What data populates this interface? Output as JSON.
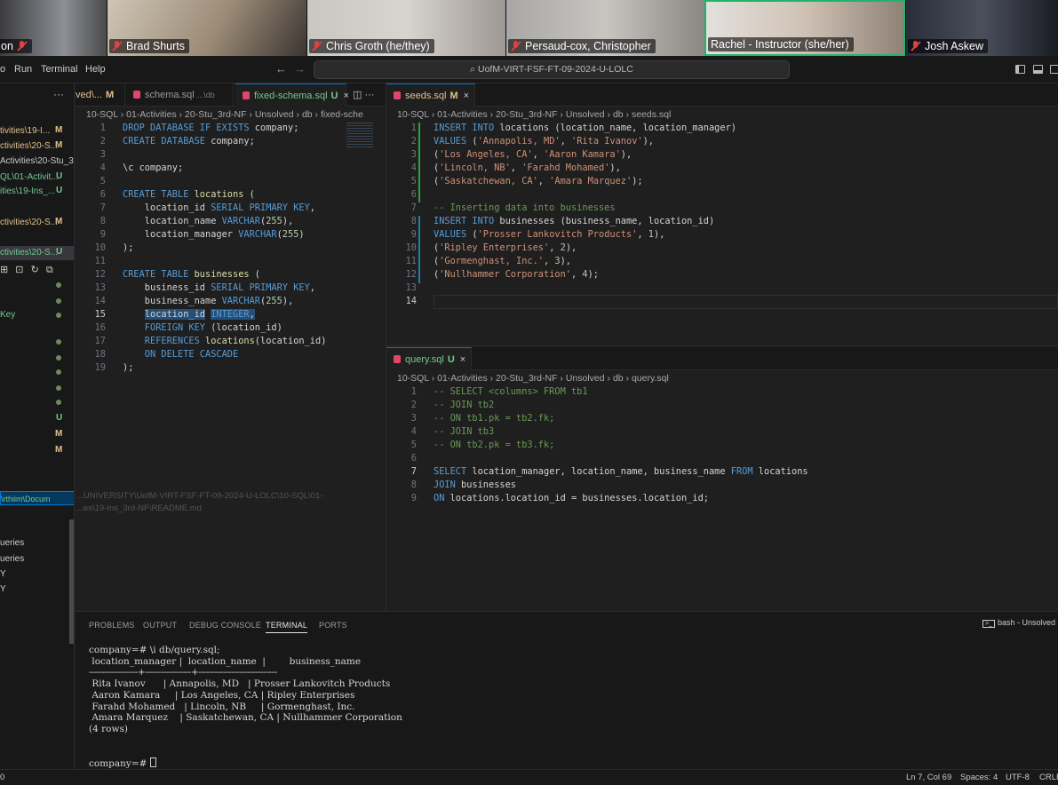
{
  "video_strip": {
    "participants": [
      {
        "name": "on",
        "muted": true
      },
      {
        "name": "Brad Shurts",
        "muted": true
      },
      {
        "name": "Chris Groth (he/they)",
        "muted": true
      },
      {
        "name": "Persaud-cox, Christopher",
        "muted": true
      },
      {
        "name": "Rachel - Instructor (she/her)",
        "muted": false
      },
      {
        "name": "Josh Askew",
        "muted": true
      }
    ]
  },
  "menubar": {
    "items": [
      "o",
      "Run",
      "Terminal",
      "Help"
    ],
    "command_center": "UofM-VIRT-FSF-FT-09-2024-U-LOLC"
  },
  "sidebar": {
    "rows": [
      {
        "label": "tivities\\19-I...",
        "badge": "M"
      },
      {
        "label": "ctivities\\20-S...",
        "badge": "M"
      },
      {
        "label": "Activities\\20-Stu_3...",
        "badge": ""
      },
      {
        "label": "QL\\01-Activit...",
        "badge": "U"
      },
      {
        "label": "ities\\19-Ins_...",
        "badge": "U"
      },
      {
        "label": "ctivities\\20-S...",
        "badge": "M"
      },
      {
        "label": "ctivities\\20-S...",
        "badge": "U"
      }
    ],
    "tree_item": "Key",
    "tree_badges": [
      "U",
      "M",
      "M"
    ],
    "path_tooltip_1": "\\rthiim\\Docum",
    "path_tooltip_2": "...UNIVERSITY\\UofM-VIRT-FSF-FT-09-2024-U-LOLC\\10-SQL\\01-",
    "path_tooltip_3": "...es\\19-Ins_3rd-NF\\README.md",
    "outline": [
      "ueries",
      "ueries",
      "Y",
      "Y"
    ]
  },
  "left_editor": {
    "tabs": [
      {
        "label": "ved\\...",
        "mod": "M"
      },
      {
        "label": "schema.sql",
        "path": "...\\db"
      },
      {
        "label": "fixed-schema.sql",
        "mod": "U"
      }
    ],
    "breadcrumb": "10-SQL › 01-Activities › 20-Stu_3rd-NF › Unsolved › db › fixed-sche",
    "current_line": 15
  },
  "seeds_editor": {
    "tab": {
      "label": "seeds.sql",
      "mod": "M"
    },
    "breadcrumb": "10-SQL › 01-Activities › 20-Stu_3rd-NF › Unsolved › db › seeds.sql",
    "current_line": 14
  },
  "query_editor": {
    "tab": {
      "label": "query.sql",
      "mod": "U"
    },
    "breadcrumb": "10-SQL › 01-Activities › 20-Stu_3rd-NF › Unsolved › db › query.sql",
    "current_line": 7
  },
  "panel": {
    "tabs": [
      "PROBLEMS",
      "OUTPUT",
      "DEBUG CONSOLE",
      "TERMINAL",
      "PORTS"
    ],
    "active_tab": "TERMINAL",
    "terminal_name": "bash - Unsolved",
    "terminal": {
      "command": "company=# \\i db/query.sql;",
      "header": " location_manager |  location_name  |        business_name",
      "separator": "------------------+-----------------+-----------------------------",
      "rows": [
        " Rita Ivanov      | Annapolis, MD   | Prosser Lankovitch Products",
        " Aaron Kamara     | Los Angeles, CA | Ripley Enterprises",
        " Farahd Mohamed   | Lincoln, NB     | Gormenghast, Inc.",
        " Amara Marquez    | Saskatchewan, CA | Nullhammer Corporation"
      ],
      "footer": "(4 rows)",
      "prompt": "company=# "
    }
  },
  "statusbar": {
    "left": "0",
    "position": "Ln 7, Col 69",
    "spaces": "Spaces: 4",
    "encoding": "UTF-8",
    "eol": "CRLF"
  },
  "colors": {
    "active_tile": "#1fb46a",
    "accent": "#0078d4",
    "modified": "#e2c08d",
    "untracked": "#73c991"
  }
}
